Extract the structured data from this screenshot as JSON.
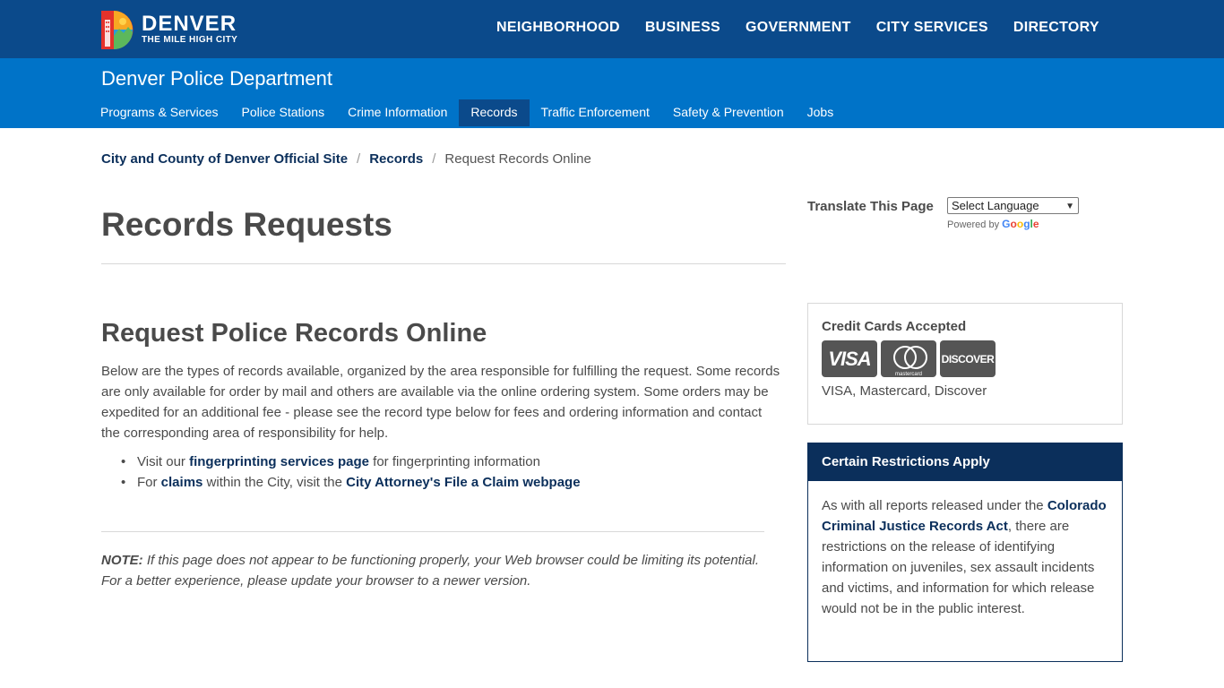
{
  "header": {
    "logo_title": "DENVER",
    "logo_subtitle": "THE MILE HIGH CITY",
    "nav": [
      "NEIGHBORHOOD",
      "BUSINESS",
      "GOVERNMENT",
      "CITY SERVICES",
      "DIRECTORY"
    ]
  },
  "subheader": {
    "title": "Denver Police Department",
    "nav": [
      {
        "label": "Programs & Services",
        "active": false
      },
      {
        "label": "Police Stations",
        "active": false
      },
      {
        "label": "Crime Information",
        "active": false
      },
      {
        "label": "Records",
        "active": true
      },
      {
        "label": "Traffic Enforcement",
        "active": false
      },
      {
        "label": "Safety & Prevention",
        "active": false
      },
      {
        "label": "Jobs",
        "active": false
      }
    ]
  },
  "breadcrumb": {
    "items": [
      "City and County of Denver Official Site",
      "Records"
    ],
    "current": "Request Records Online"
  },
  "page": {
    "title": "Records Requests"
  },
  "translate": {
    "label": "Translate This Page",
    "select_value": "Select Language",
    "powered_by": "Powered by",
    "google": "Google"
  },
  "main": {
    "section_title": "Request Police Records Online",
    "intro": "Below are the types of records available, organized by the area responsible for fulfilling the request.  Some records are only available for order by mail and others are available via the online ordering system.  Some orders may be expedited for an additional fee - please see the record type below for fees and ordering information and contact the corresponding area of responsibility for help.",
    "bullet1": {
      "pre": "Visit our ",
      "link": "fingerprinting services page",
      "post": " for fingerprinting information"
    },
    "bullet2": {
      "pre": "For ",
      "link1": "claims",
      "mid": " within the City, visit the ",
      "link2": "City Attorney's File a Claim webpage"
    },
    "note_label": "NOTE:",
    "note_text": " If this page does not appear to be functioning properly, your Web browser could be limiting its potential.  For a better experience, please update your browser to a newer version."
  },
  "sidebar": {
    "cards_title": "Credit Cards Accepted",
    "card_logos": {
      "visa": "VISA",
      "mastercard": "mastercard",
      "discover": "DISCOVER"
    },
    "cards_text": "VISA, Mastercard, Discover",
    "restrictions_title": "Certain Restrictions Apply",
    "restrictions_pre": "As with all reports released under the ",
    "restrictions_link": "Colorado Criminal Justice Records Act",
    "restrictions_post": ", there are restrictions on the release of identifying information on juveniles, sex assault incidents and victims, and information for which release would not be in the public interest."
  },
  "colors": {
    "topbar": "#0b4a8b",
    "subheader": "#0073c8",
    "active_tab": "#0b4a8b",
    "link": "#0b2f5b"
  }
}
